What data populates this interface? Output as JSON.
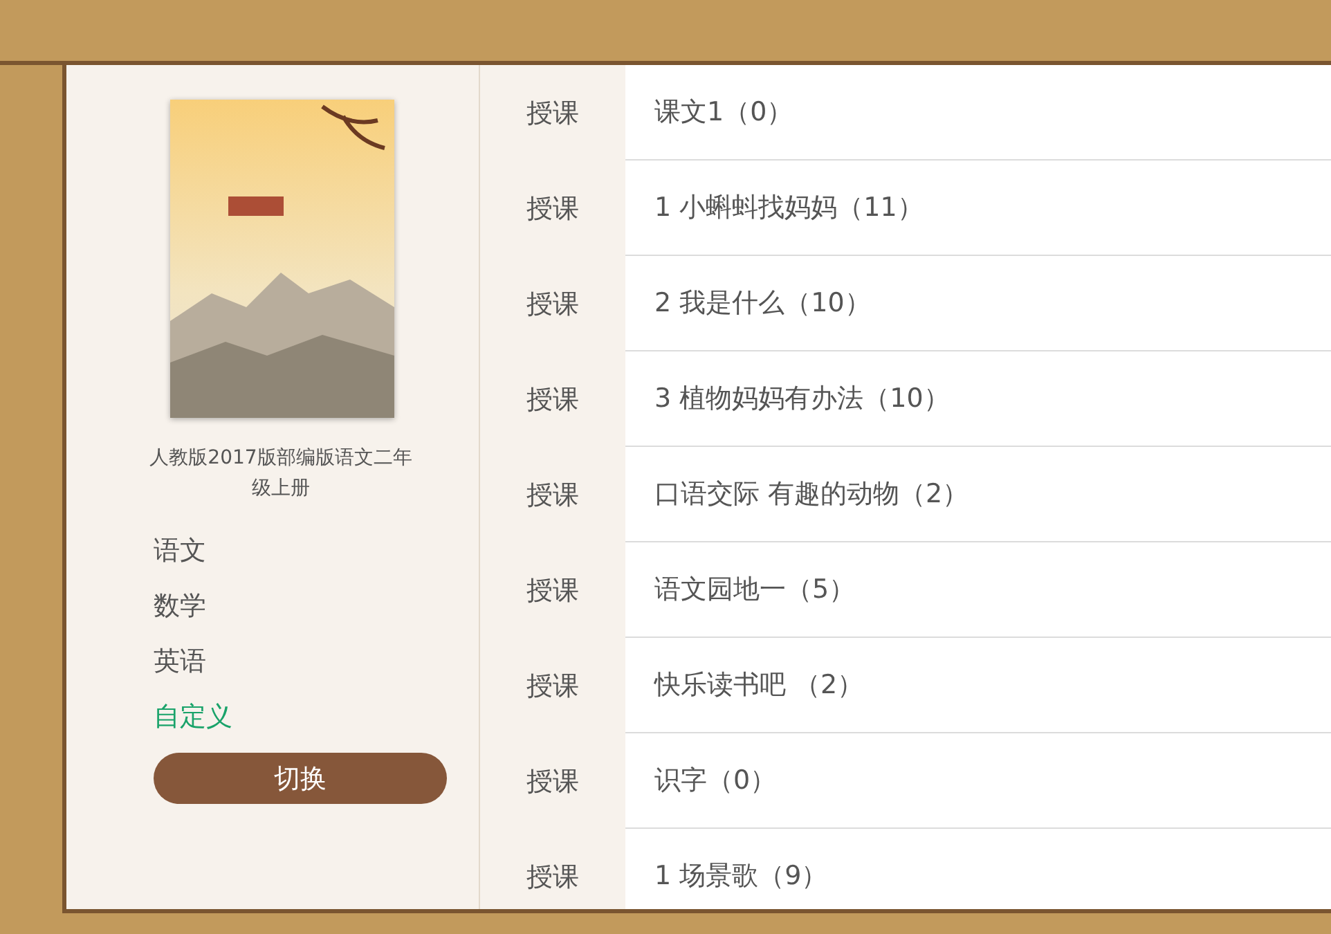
{
  "book": {
    "title": "人教版2017版部编版语文二年级上册"
  },
  "subjects": [
    {
      "label": "语文",
      "selected": false
    },
    {
      "label": "数学",
      "selected": false
    },
    {
      "label": "英语",
      "selected": false
    },
    {
      "label": "自定义",
      "selected": true
    }
  ],
  "switch_button": "切换",
  "lessons": [
    {
      "action": "授课",
      "title": "课文1（0）"
    },
    {
      "action": "授课",
      "title": "1 小蝌蚪找妈妈（11）"
    },
    {
      "action": "授课",
      "title": "2 我是什么（10）"
    },
    {
      "action": "授课",
      "title": "3 植物妈妈有办法（10）"
    },
    {
      "action": "授课",
      "title": "口语交际 有趣的动物（2）"
    },
    {
      "action": "授课",
      "title": "语文园地一（5）"
    },
    {
      "action": "授课",
      "title": "快乐读书吧 （2）"
    },
    {
      "action": "授课",
      "title": "识字（0）"
    },
    {
      "action": "授课",
      "title": "1 场景歌（9）"
    }
  ]
}
